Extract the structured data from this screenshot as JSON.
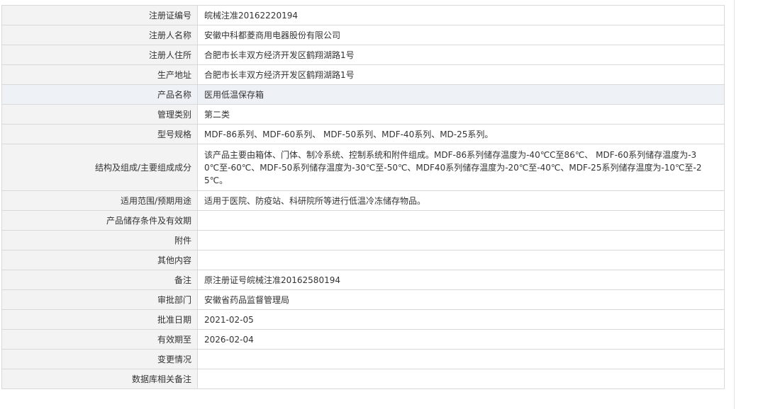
{
  "rows": [
    {
      "label": "注册证编号",
      "value": "皖械注准20162220194"
    },
    {
      "label": "注册人名称",
      "value": "安徽中科都菱商用电器股份有限公司"
    },
    {
      "label": "注册人住所",
      "value": "合肥市长丰双方经济开发区鹤翔湖路1号"
    },
    {
      "label": "生产地址",
      "value": "合肥市长丰双方经济开发区鹤翔湖路1号"
    },
    {
      "label": "产品名称",
      "value": "医用低温保存箱"
    },
    {
      "label": "管理类别",
      "value": "第二类"
    },
    {
      "label": "型号规格",
      "value": "MDF-86系列、MDF-60系列、 MDF-50系列、MDF-40系列、MD-25系列。"
    },
    {
      "label": "结构及组成/主要组成成分",
      "value": "该产品主要由箱体、门体、制冷系统、控制系统和附件组成。MDF-86系列储存温度为-40℃C至86℃、 MDF-60系列储存温度为-30℃至-60℃、MDF-50系列储存温度为-30℃至-50℃、MDF40系列储存温度为-20℃至-40℃、MDF-25系列储存温度为-10℃至-25℃。"
    },
    {
      "label": "适用范围/预期用途",
      "value": "适用于医院、防疫站、科研院所等进行低温冷冻储存物品。"
    },
    {
      "label": "产品储存条件及有效期",
      "value": ""
    },
    {
      "label": "附件",
      "value": ""
    },
    {
      "label": "其他内容",
      "value": ""
    },
    {
      "label": "备注",
      "value": "原注册证号皖械注准20162580194"
    },
    {
      "label": "审批部门",
      "value": "安徽省药品监督管理局"
    },
    {
      "label": "批准日期",
      "value": "2021-02-05"
    },
    {
      "label": "有效期至",
      "value": "2026-02-04"
    },
    {
      "label": "变更情况",
      "value": ""
    },
    {
      "label": "数据库相关备注",
      "value": ""
    }
  ],
  "colors": {
    "label_bg": "#f3f3f3",
    "highlight_bg": "#eef1f6",
    "border": "#d9d9d9",
    "text": "#333333"
  }
}
